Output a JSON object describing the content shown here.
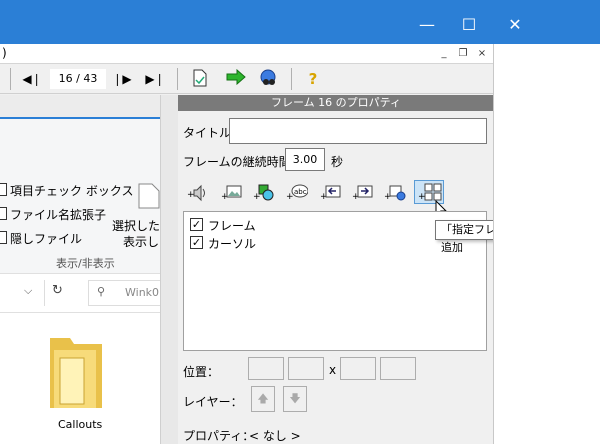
{
  "window": {
    "minimize_glyph": "—",
    "maximize_glyph": "☐",
    "close_glyph": "✕",
    "accent_color": "#2b7fd6"
  },
  "menubar": {
    "left_fragment": ")",
    "mdi_minimize": "_",
    "mdi_restore": "❐",
    "mdi_close": "×"
  },
  "toolbar": {
    "prev_glyph": "◀❘",
    "page_counter": "16 / 43",
    "next_glyph": "❘▶",
    "last_glyph": "▶❘"
  },
  "explorer": {
    "ribbon_items": [
      "項目チェック ボックス",
      "ファイル名拡張子",
      "隠しファイル"
    ],
    "ribbon_side_label_1": "選択した項",
    "ribbon_side_label_2": "表示し",
    "ribbon_group_label": "表示/非表示",
    "search_placeholder": "Wink0",
    "folder_label": "Callouts"
  },
  "panel": {
    "header": "フレーム 16 のプロパティ",
    "title_label": "タイトル",
    "title_value": "",
    "duration_label": "フレームの継続時間",
    "duration_value": "3.00",
    "duration_unit": "秒",
    "list_items": [
      {
        "label": "フレーム",
        "checked": true
      },
      {
        "label": "カーソル",
        "checked": true
      }
    ],
    "position_label": "位置：",
    "position_x_sep": "x",
    "layer_label": "レイヤー：",
    "property_label": "プロパティ：",
    "property_value": "< なし >"
  },
  "tooltip": {
    "text": "「指定フレームへ」ボタンの追加"
  }
}
